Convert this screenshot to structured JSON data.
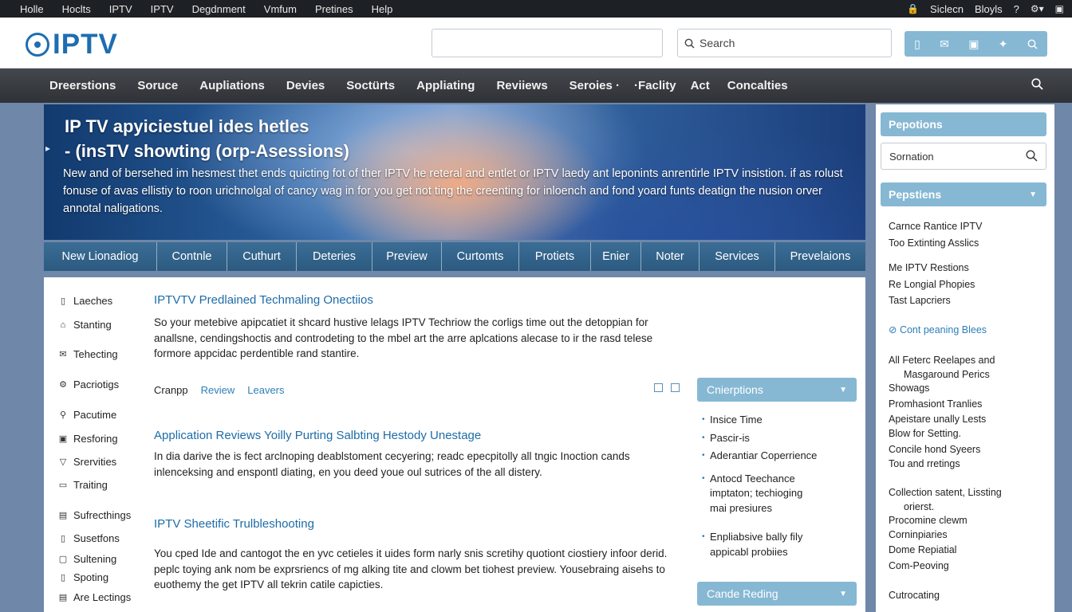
{
  "topbar": {
    "menu": [
      "Holle",
      "Hoclts",
      "IPTV",
      "IPTV",
      "Degdnment",
      "Vmfum",
      "Pretines",
      "Help"
    ],
    "right": [
      "Siclecn",
      "Bloyls",
      "?"
    ]
  },
  "header": {
    "logo_text": "IPTV",
    "search_placeholder": "Search"
  },
  "nav": {
    "items": [
      "Dreerstions",
      "Soruce",
      "Aupliations",
      "Devies",
      "Soctürts",
      "Appliating",
      "Reviiews",
      "Seroies ·",
      "·Faclity",
      "Act",
      "Concalties"
    ]
  },
  "hero": {
    "title_line1": "IP TV apyiciestuel ides hetles",
    "title_line2": "- (insTV showting (orp-Asessions)",
    "body": "New and of bersehed im hesmest thet ends quicting fot of ther IPTV he reteral and entlet or IPTV laedy ant leponints anrentirle IPTV insistion. if as rolust fonuse of avas ellistiy to roon urichnolgal of cancy wag in for you get not ting the creenting for inloench and fond yoard funts deatign the nusion orver annotal naligations."
  },
  "tabs": [
    "New Lionadiog",
    "Contnle",
    "Cuthurt",
    "Deteries",
    "Preview",
    "Curtomts",
    "Protiets",
    "Enier",
    "Noter",
    "Services",
    "Prevelaions"
  ],
  "left_list": [
    {
      "label": "Laeches",
      "icon": "▯"
    },
    {
      "label": "Stanting",
      "icon": "⌂"
    },
    {
      "label": "Tehecting",
      "icon": "✉"
    },
    {
      "label": "Pacriotigs",
      "icon": "⚙"
    },
    {
      "label": "Pacutime",
      "icon": "⚲"
    },
    {
      "label": "Resforing",
      "icon": "▣"
    },
    {
      "label": "Srervities",
      "icon": "▽"
    },
    {
      "label": "Traiting",
      "icon": "▭"
    },
    {
      "label": "Sufrecthings",
      "icon": "▤"
    },
    {
      "label": "Susetfons",
      "icon": "▯"
    },
    {
      "label": "Sultening",
      "icon": "▢"
    },
    {
      "label": "Spoting",
      "icon": "▯"
    },
    {
      "label": "Are Lectings",
      "icon": "▤"
    }
  ],
  "content": {
    "h1": "IPTVTV Predlained Techmaling Onectiios",
    "p1": "So your metebive apipcatiet it shcard hustive lelags IPTV Techriow the corligs time out the detoppian for anallsne, cendingshoctis and controdeting to the mbel art the arre aplcations alecase to ir the rasd telese formore appcidac perdentible rand stantire.",
    "subtabs": [
      "Cranpp",
      "Review",
      "Leavers"
    ],
    "h2": "Application Reviews Yoilly Purting Salbting Hestody Unestage",
    "p2": "In dia darive the is fect arclnoping deablstoment cecyering; readc epecpitolly all tngic Inoction cands inlenceksing and enspontl diating, en you deed youe oul sutrices of the all distery.",
    "h3": "IPTV Sheetific Trulbleshooting",
    "p3": "You cped Ide and cantogot the en yvc cetieles it uides form narly snis scretihy quotiont ciostiery infoor derid. peplc toying ank nom be exprsriencs of mg alking tite and clowm bet tiohest preview. Yousebraing aisehs to euothemy the get IPTV all tekrin catile capicties."
  },
  "side_box1": {
    "title": "Cnierptions",
    "items": [
      "Insice Time",
      "Pascir-is",
      "Aderantiar Coperrience",
      "Antocd Teechance imptaton; techioging mai presiures",
      "Enpliabsive bally fily appicabl probiies"
    ]
  },
  "side_box2": {
    "title": "Cande Reding"
  },
  "rsidebar": {
    "head1": "Pepotions",
    "search_placeholder": "Sornation",
    "head2": "Pepstiens",
    "list1": [
      "Carnce Rantice IPTV",
      "Too Extinting Asslics"
    ],
    "list2": [
      "Me IPTV Restions",
      "Re Longial Phopies",
      "Tast Lapcriers"
    ],
    "link": "Cont peaning Blees",
    "list3": [
      "All Feterc Reelapes and",
      "Masgaround Perics",
      "Showags",
      "Promhasiont Tranlies",
      "Apeistare unally Lests",
      "Blow for Setting.",
      "Concile hond Syeers",
      "Tou and rretings"
    ],
    "list4": [
      "Collection satent, Lissting",
      "orierst.",
      "Procomine clewm",
      "Corninpiaries",
      "Dome Repiatial",
      "Com-Peoving"
    ],
    "last": "Cutrocating"
  }
}
